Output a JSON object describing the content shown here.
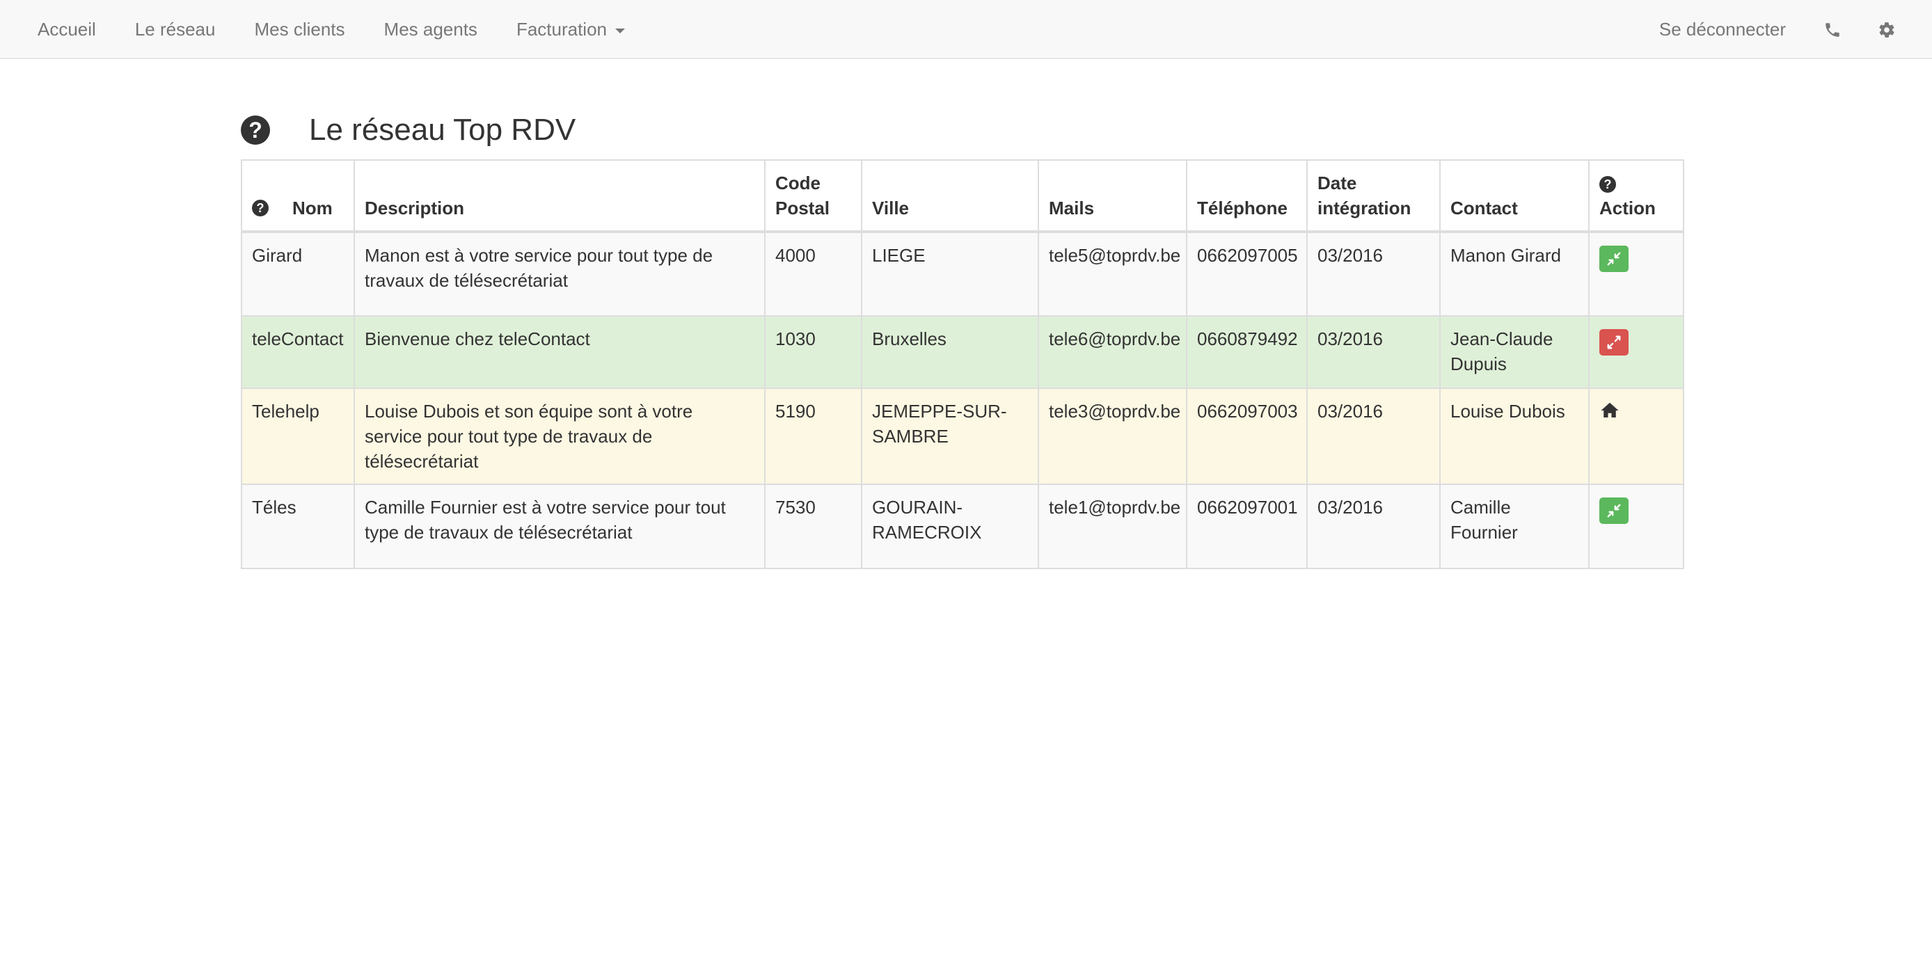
{
  "navbar": {
    "items": [
      {
        "label": "Accueil"
      },
      {
        "label": "Le réseau"
      },
      {
        "label": "Mes clients"
      },
      {
        "label": "Mes agents"
      },
      {
        "label": "Facturation"
      }
    ],
    "logout_label": "Se déconnecter",
    "icons": [
      "phone-icon",
      "gear-icon"
    ]
  },
  "page": {
    "title": "Le réseau Top RDV",
    "help_glyph": "?"
  },
  "table": {
    "columns": {
      "nom": "Nom",
      "description": "Description",
      "code_postal_1": "Code",
      "code_postal_2": "Postal",
      "ville": "Ville",
      "mails": "Mails",
      "telephone": "Téléphone",
      "date_1": "Date",
      "date_2": "intégration",
      "contact": "Contact",
      "action": "Action"
    },
    "rows": [
      {
        "nom": "Girard",
        "description": "Manon est à votre service pour tout type de travaux de télésecrétariat",
        "code_postal": "4000",
        "ville": "LIEGE",
        "mail": "tele5@toprdv.be",
        "telephone": "0662097005",
        "date": "03/2016",
        "contact": "Manon Girard",
        "action": "compress",
        "action_color": "#5cb85c",
        "row_style": "default"
      },
      {
        "nom": "teleContact",
        "description": "Bienvenue chez teleContact",
        "code_postal": "1030",
        "ville": "Bruxelles",
        "mail": "tele6@toprdv.be",
        "telephone": "0660879492",
        "date": "03/2016",
        "contact": "Jean-Claude Dupuis",
        "action": "expand",
        "action_color": "#d9534f",
        "row_style": "success"
      },
      {
        "nom": "Telehelp",
        "description": "Louise Dubois et son équipe sont à votre service pour tout type de travaux de télésecrétariat",
        "code_postal": "5190",
        "ville": "JEMEPPE-SUR-SAMBRE",
        "mail": "tele3@toprdv.be",
        "telephone": "0662097003",
        "date": "03/2016",
        "contact": "Louise Dubois",
        "action": "home",
        "action_color": "#333333",
        "row_style": "warning"
      },
      {
        "nom": "Téles",
        "description": "Camille Fournier est à votre service pour tout type de travaux de télésecrétariat",
        "code_postal": "7530",
        "ville": "GOURAIN-RAMECROIX",
        "mail": "tele1@toprdv.be",
        "telephone": "0662097001",
        "date": "03/2016",
        "contact": "Camille Fournier",
        "action": "compress",
        "action_color": "#5cb85c",
        "row_style": "plain"
      }
    ]
  }
}
